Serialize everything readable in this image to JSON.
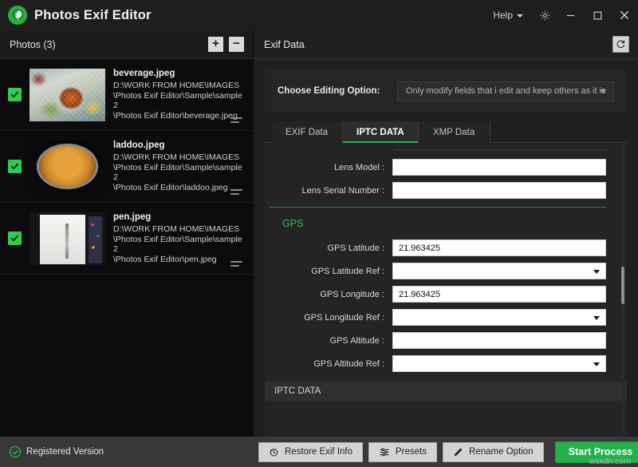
{
  "window": {
    "app_title": "Photos Exif Editor",
    "help_label": "Help",
    "settings_icon": "gear-icon",
    "minimize_icon": "minimize-icon",
    "maximize_icon": "maximize-icon",
    "close_icon": "close-icon"
  },
  "photos_panel": {
    "title": "Photos (3)",
    "add_label": "+",
    "remove_label": "−",
    "items": [
      {
        "name": "beverage.jpeg",
        "path": "D:\\WORK FROM HOME\\IMAGES\n\\Photos Exif Editor\\Sample\\sample 2\n\\Photos Exif Editor\\beverage.jpeg",
        "checked": true
      },
      {
        "name": "laddoo.jpeg",
        "path": "D:\\WORK FROM HOME\\IMAGES\n\\Photos Exif Editor\\Sample\\sample 2\n\\Photos Exif Editor\\laddoo.jpeg",
        "checked": true
      },
      {
        "name": "pen.jpeg",
        "path": "D:\\WORK FROM HOME\\IMAGES\n\\Photos Exif Editor\\Sample\\sample 2\n\\Photos Exif Editor\\pen.jpeg",
        "checked": true
      }
    ]
  },
  "exif_panel": {
    "title": "Exif Data",
    "refresh_icon": "refresh-icon",
    "editing_option": {
      "label": "Choose Editing Option:",
      "selected": "Only modify fields that i edit and keep others as it is"
    },
    "tabs": [
      {
        "label": "EXIF Data",
        "active": false
      },
      {
        "label": "IPTC DATA",
        "active": true
      },
      {
        "label": "XMP Data",
        "active": false
      }
    ],
    "fields_top": [
      {
        "label": "Lens Model :",
        "value": "",
        "type": "text"
      },
      {
        "label": "Lens Serial Number :",
        "value": "",
        "type": "text"
      }
    ],
    "gps_heading": "GPS",
    "fields_gps": [
      {
        "label": "GPS Latitude :",
        "value": "21.963425",
        "type": "text"
      },
      {
        "label": "GPS Latitude Ref :",
        "value": "",
        "type": "select"
      },
      {
        "label": "GPS Longitude :",
        "value": "21.963425",
        "type": "text"
      },
      {
        "label": "GPS Longitude Ref :",
        "value": "",
        "type": "select"
      },
      {
        "label": "GPS Altitude :",
        "value": "",
        "type": "text"
      },
      {
        "label": "GPS Altitude Ref :",
        "value": "",
        "type": "select"
      }
    ],
    "section_bar": "IPTC DATA"
  },
  "status_bar": {
    "registered_text": "Registered Version",
    "check_icon": "check-circle-icon"
  },
  "toolbar": {
    "restore_label": "Restore Exif Info",
    "restore_icon": "restore-icon",
    "presets_label": "Presets",
    "presets_icon": "sliders-icon",
    "rename_label": "Rename Option",
    "rename_icon": "pencil-icon",
    "start_label": "Start Process"
  },
  "watermark": "wsxdn.com",
  "colors": {
    "accent_green": "#22b14c",
    "check_green": "#2ecc57",
    "gps_green": "#2fbb55"
  }
}
